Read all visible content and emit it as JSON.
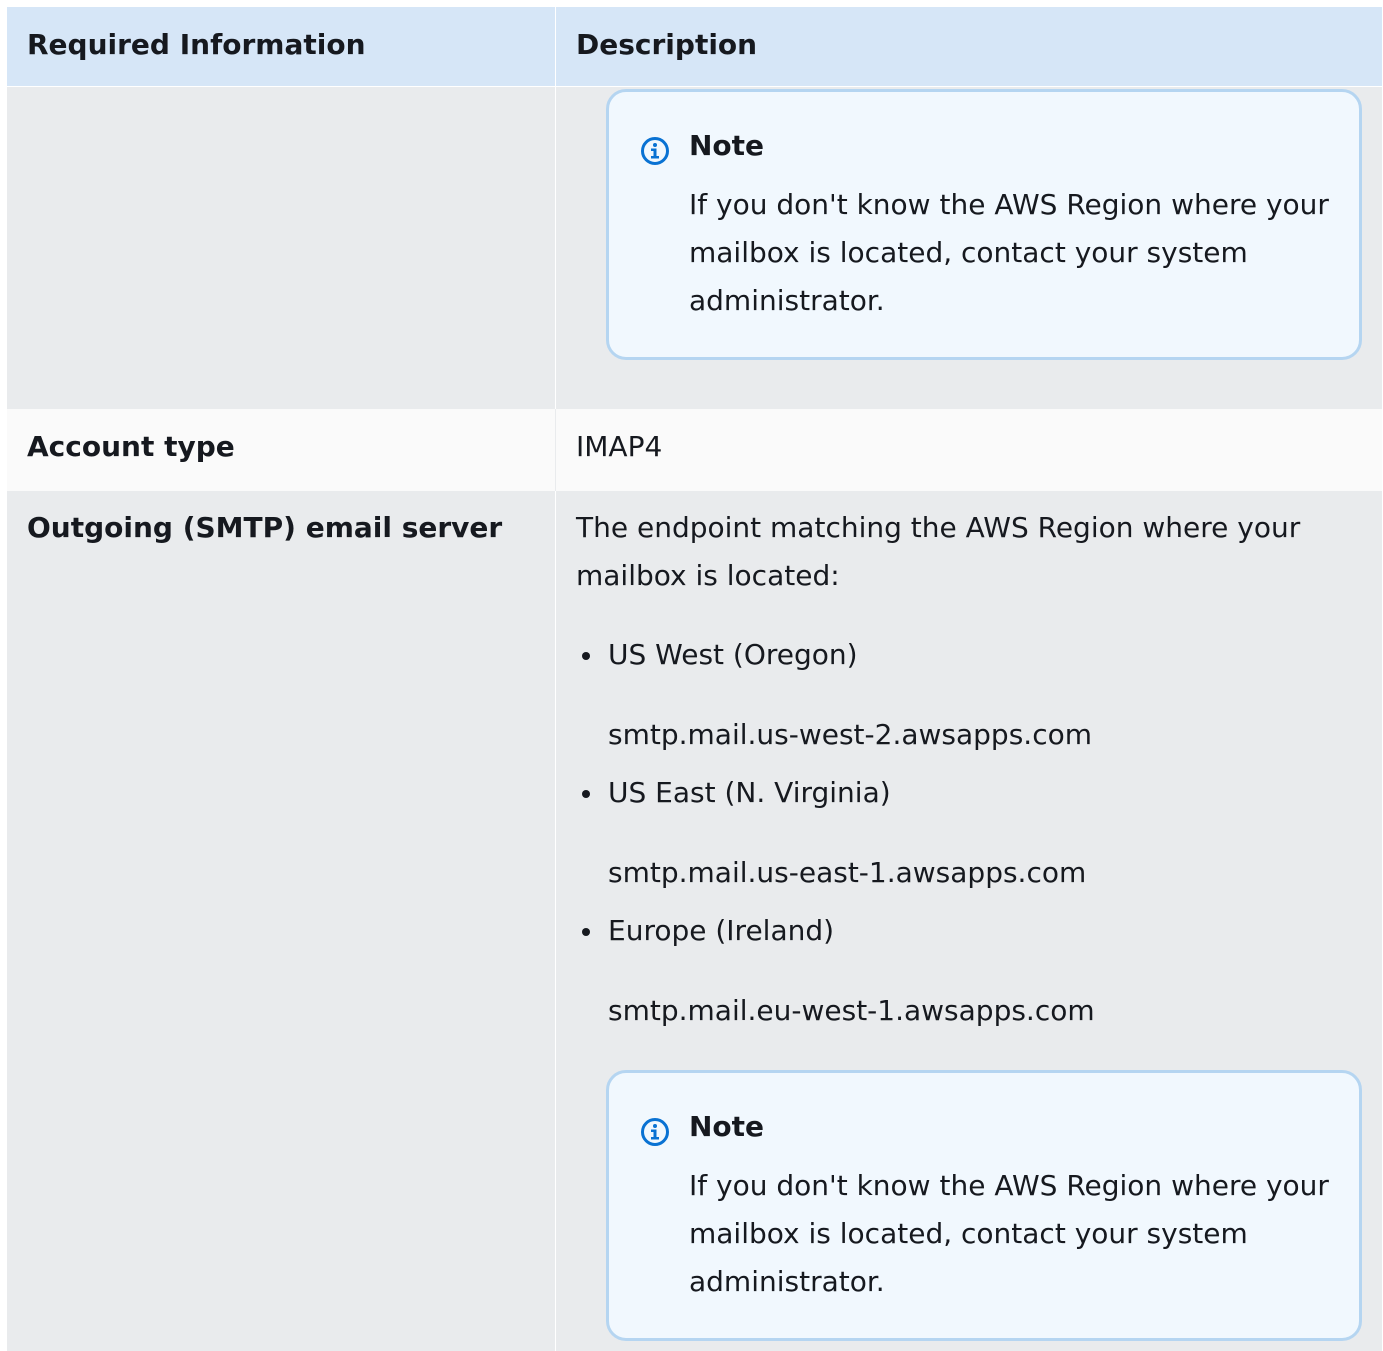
{
  "table": {
    "header": {
      "col1": "Required Information",
      "col2": "Description"
    },
    "continuation_note": {
      "title": "Note",
      "text": "If you don't know the AWS Region where your mailbox is located, contact your system administrator."
    },
    "account_type": {
      "label": "Account type",
      "value": "IMAP4"
    },
    "smtp": {
      "label": "Outgoing (SMTP) email server",
      "intro": "The endpoint matching the AWS Region where your mailbox is located:",
      "regions": [
        {
          "name": "US West (Oregon)",
          "endpoint": "smtp.mail.us-west-2.awsapps.com"
        },
        {
          "name": "US East (N. Virginia)",
          "endpoint": "smtp.mail.us-east-1.awsapps.com"
        },
        {
          "name": "Europe (Ireland)",
          "endpoint": "smtp.mail.eu-west-1.awsapps.com"
        }
      ],
      "note": {
        "title": "Note",
        "text": "If you don't know the AWS Region where your mailbox is located, contact your system administrator."
      }
    }
  },
  "colors": {
    "header_bg": "#d6e6f7",
    "row_bg": "#e9ebed",
    "row_alt_bg": "#fafafa",
    "note_bg": "#f1f8fe",
    "note_border": "#b5d5f1",
    "info_icon": "#0972d3"
  },
  "icons": {
    "note_icon": "info-circle-icon"
  }
}
